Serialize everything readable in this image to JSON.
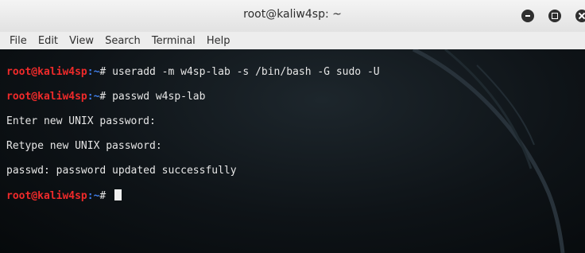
{
  "window": {
    "title": "root@kaliw4sp: ~"
  },
  "menu": [
    {
      "label": "File"
    },
    {
      "label": "Edit"
    },
    {
      "label": "View"
    },
    {
      "label": "Search"
    },
    {
      "label": "Terminal"
    },
    {
      "label": "Help"
    }
  ],
  "terminal": {
    "prompt": {
      "user_host": "root@kaliw4sp",
      "path": ":~",
      "symbol": "# "
    },
    "lines": [
      {
        "type": "command",
        "text": "useradd -m w4sp-lab -s /bin/bash -G sudo -U"
      },
      {
        "type": "command",
        "text": "passwd w4sp-lab"
      },
      {
        "type": "output",
        "text": "Enter new UNIX password:"
      },
      {
        "type": "output",
        "text": "Retype new UNIX password:"
      },
      {
        "type": "output",
        "text": "passwd: password updated successfully"
      },
      {
        "type": "prompt",
        "text": ""
      }
    ],
    "colors": {
      "user_host": "#ef2a2a",
      "path": "#3f7de8",
      "text": "#e6e6e6",
      "background": "#0e1317"
    }
  },
  "icons": {
    "minimize": "minimize-icon",
    "maximize": "maximize-icon",
    "close": "close-icon"
  }
}
